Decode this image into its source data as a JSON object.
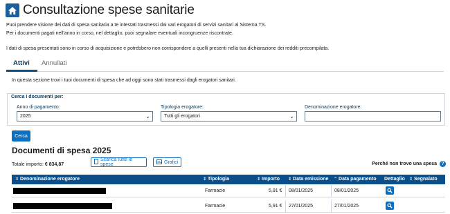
{
  "header": {
    "title": "Consultazione spese sanitarie"
  },
  "intro": {
    "line1": "Puoi prendere visione dei dati di spesa sanitaria a te intestati trasmessi dai vari erogatori di servizi sanitari al Sistema TS.",
    "line2": "Per i documenti pagati nell'anno in corso, nel dettaglio, puoi segnalare eventuali incongruenze riscontrate.",
    "line3": "I dati di spesa presentati sono in corso di acquisizione e potrebbero non corrispondere a quelli presenti nella tua dichiarazione dei redditi precompilata."
  },
  "tabs": [
    {
      "label": "Attivi",
      "active": true
    },
    {
      "label": "Annullati",
      "active": false
    }
  ],
  "tab_description": "In questa sezione trovi i tuoi documenti di spesa che ad oggi sono stati trasmessi dagli erogatori sanitari.",
  "search": {
    "legend": "Cerca i documenti per:",
    "year_label": "Anno di pagamento:",
    "year_value": "2025",
    "type_label": "Tipologia erogatore:",
    "type_value": "Tutti gli erogatori",
    "name_label": "Denominazione erogatore:",
    "name_value": "",
    "submit_label": "Cerca"
  },
  "results": {
    "title": "Documenti di spesa 2025",
    "total_label": "Totale importo:",
    "total_value": "€ 834,87",
    "download_label": "Scarica tutte le spese",
    "charts_label": "Grafici",
    "help_label": "Perché non trovo una spesa"
  },
  "table": {
    "columns": {
      "name": "Denominazione erogatore",
      "type": "Tipologia",
      "amount": "Importo",
      "issue_date": "Data emissione",
      "pay_date": "Data pagamento",
      "detail": "Dettaglio",
      "reported": "Segnalato"
    },
    "rows": [
      {
        "type": "Farmacie",
        "amount": "5,91 €",
        "issue_date": "08/01/2025",
        "pay_date": "08/01/2025"
      },
      {
        "type": "Farmacie",
        "amount": "5,91 €",
        "issue_date": "27/01/2025",
        "pay_date": "27/01/2025"
      }
    ]
  },
  "colors": {
    "primary": "#0b6fc2",
    "header_bar": "#0b4f8a",
    "title_blue": "#06395f"
  }
}
